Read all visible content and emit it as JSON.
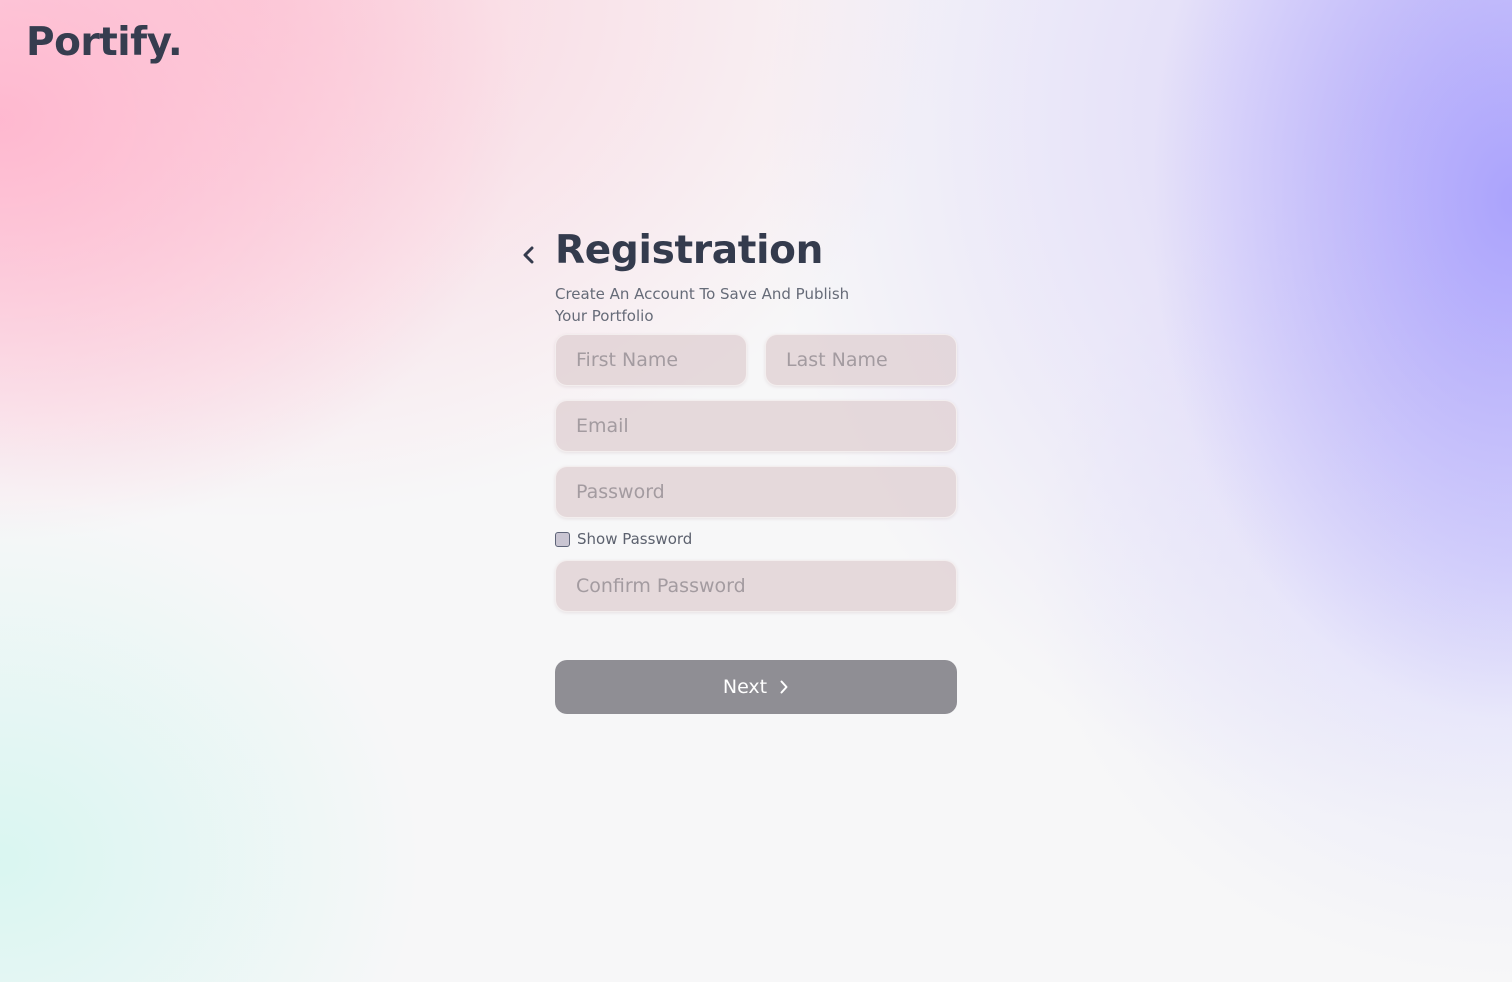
{
  "brand": {
    "logo_text": "Portify."
  },
  "form": {
    "title": "Registration",
    "subtitle": "Create An Account To Save And Publish Your Portfolio",
    "first_name_placeholder": "First Name",
    "last_name_placeholder": "Last Name",
    "email_placeholder": "Email",
    "password_placeholder": "Password",
    "show_password_label": "Show Password",
    "show_password_checked": false,
    "confirm_password_placeholder": "Confirm Password",
    "next_label": "Next"
  },
  "icons": {
    "back": "chevron-left-icon",
    "next": "chevron-right-icon"
  },
  "colors": {
    "text_dark": "#343b4d",
    "button_bg": "#8f8e94",
    "field_bg": "#decdd0"
  }
}
